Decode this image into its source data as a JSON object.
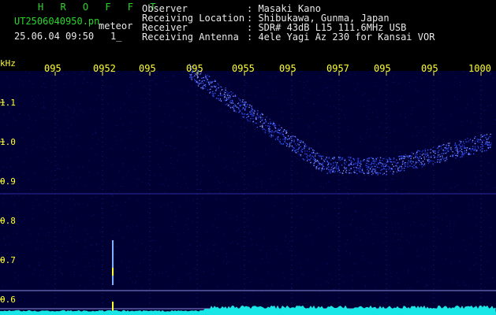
{
  "header": {
    "brand": "H R O F F T",
    "file_name": "UT2506040950.pn",
    "tag": "meteor",
    "datetime": "25.06.04 09:50",
    "counter": "1_",
    "fields": [
      {
        "label": "Observer",
        "value": ": Masaki Kano"
      },
      {
        "label": "Receiving Location",
        "value": ": Shibukawa, Gunma, Japan"
      },
      {
        "label": "Receiver",
        "value": ": SDR# 43dB L15 111.6MHz USB"
      },
      {
        "label": "Receiving Antenna",
        "value": ": 4ele Yagi Az 230 for Kansai VOR"
      }
    ]
  },
  "axis": {
    "unit": "kHz",
    "time_ticks": [
      "095",
      "0952",
      "095",
      "095",
      "0955",
      "095",
      "0957",
      "095",
      "095",
      "1000"
    ],
    "freq_ticks": [
      "1.1",
      "1.0",
      "0.9",
      "0.8",
      "0.7",
      "0.6"
    ]
  },
  "colors": {
    "label": "#ffff33",
    "brand": "#2bd62b",
    "signal": "#3a5cff",
    "trace": "#19e6e6"
  }
}
